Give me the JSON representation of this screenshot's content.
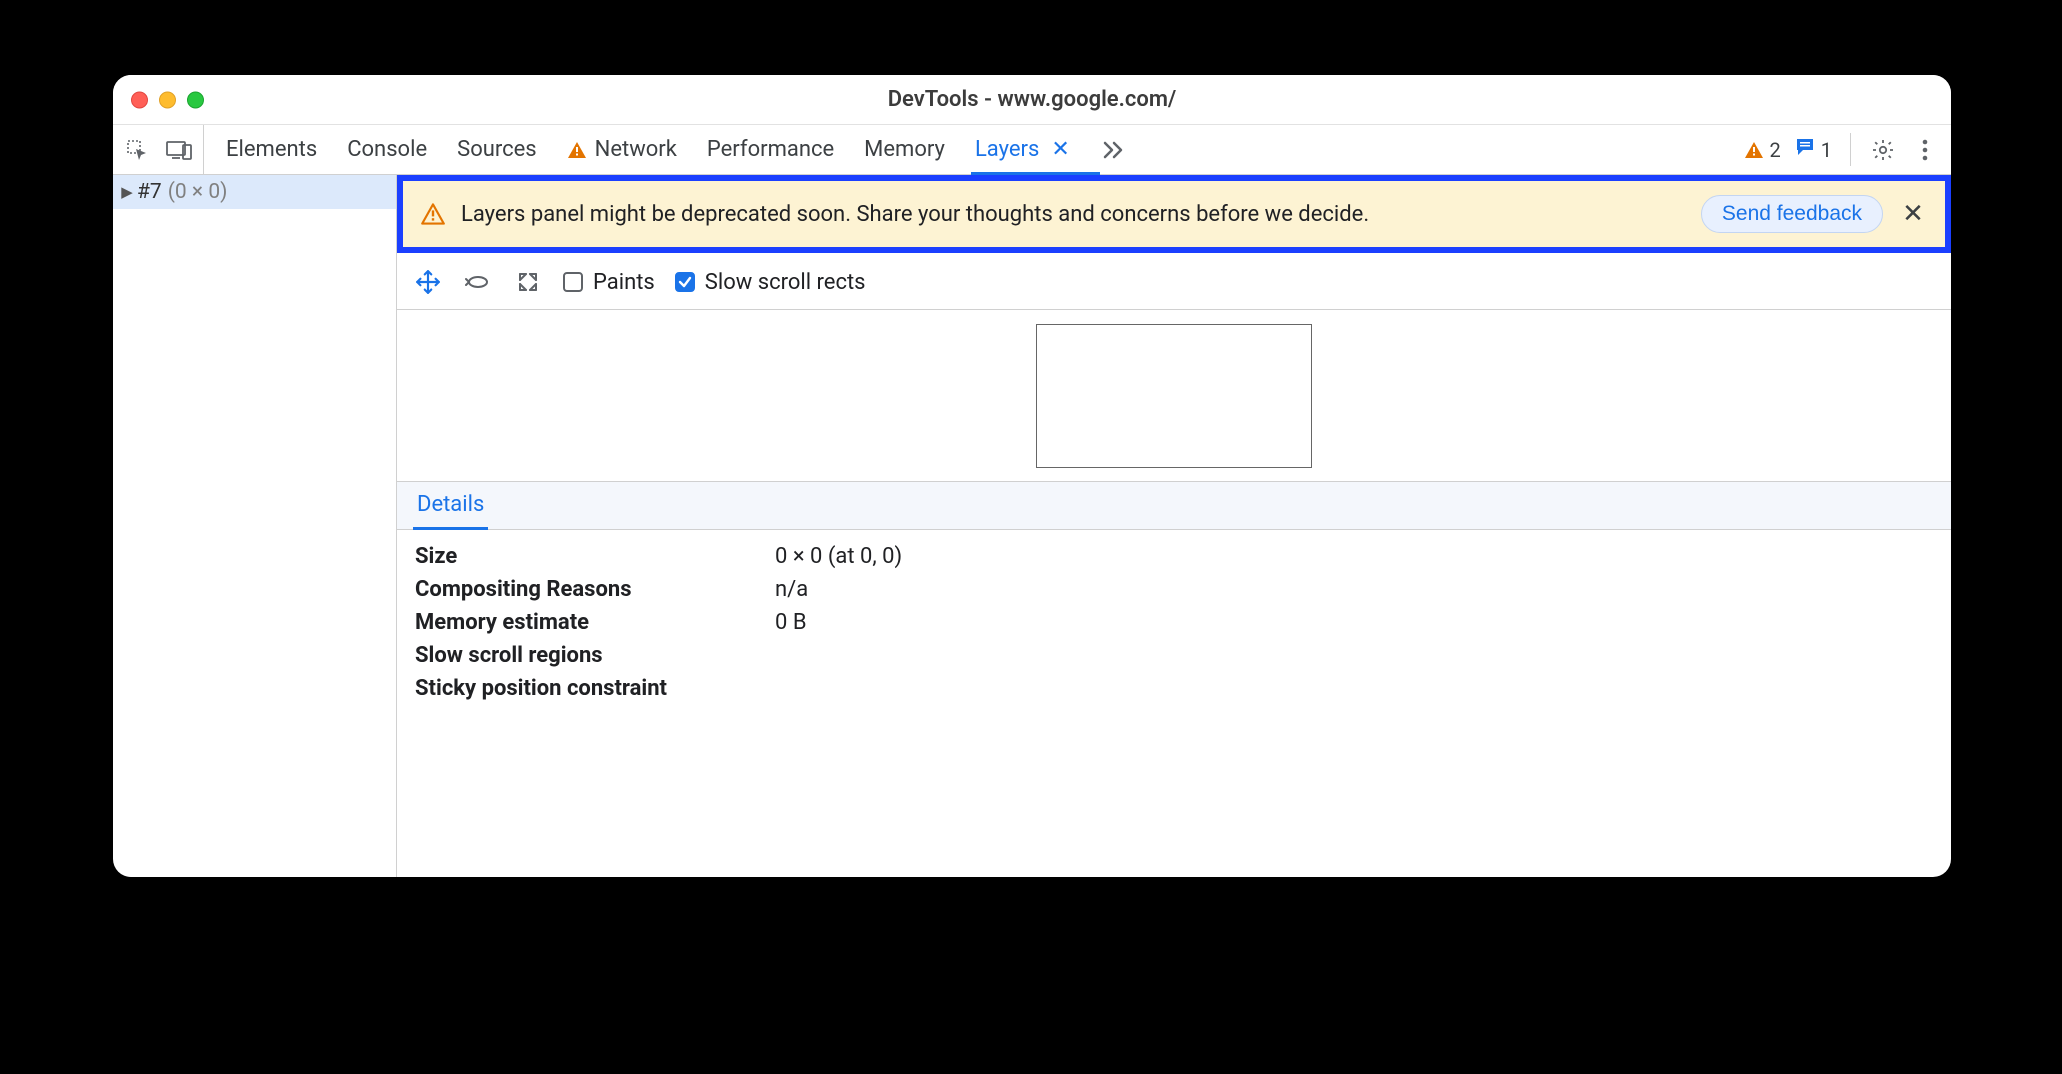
{
  "window": {
    "title": "DevTools - www.google.com/"
  },
  "toolbar": {
    "tabs": {
      "elements": "Elements",
      "console": "Console",
      "sources": "Sources",
      "network": "Network",
      "performance": "Performance",
      "memory": "Memory",
      "layers": "Layers"
    },
    "badges": {
      "issues_count": "2",
      "messages_count": "1"
    }
  },
  "tree": {
    "items": [
      {
        "id": "#7",
        "dims": "(0 × 0)"
      }
    ]
  },
  "banner": {
    "message": "Layers panel might be deprecated soon. Share your thoughts and concerns before we decide.",
    "cta": "Send feedback"
  },
  "controls": {
    "paints_label": "Paints",
    "paints_checked": false,
    "slow_scroll_label": "Slow scroll rects",
    "slow_scroll_checked": true
  },
  "details": {
    "tab_label": "Details",
    "rows": {
      "size": {
        "label": "Size",
        "value": "0 × 0 (at 0, 0)"
      },
      "compositing": {
        "label": "Compositing Reasons",
        "value": "n/a"
      },
      "memory": {
        "label": "Memory estimate",
        "value": "0 B"
      },
      "slow_scroll": {
        "label": "Slow scroll regions",
        "value": ""
      },
      "sticky": {
        "label": "Sticky position constraint",
        "value": ""
      }
    }
  },
  "icons": {
    "inspect": "inspect-icon",
    "device": "device-icon",
    "warning": "warning-icon",
    "chat": "chat-icon",
    "gear": "gear-icon",
    "kebab": "kebab-icon",
    "more_tabs": "chevron-double-right-icon",
    "close": "close-icon",
    "pan": "move-icon",
    "rotate": "rotate-icon",
    "reset": "reset-view-icon"
  },
  "colors": {
    "accent": "#1a73e8",
    "banner_bg": "#fdf3d3",
    "banner_border": "#1b3fff",
    "warning": "#e37400"
  }
}
